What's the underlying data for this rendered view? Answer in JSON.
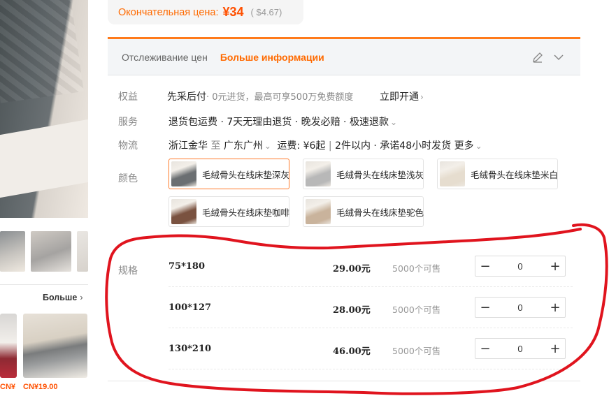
{
  "final_price": {
    "label": "Окончательная цена:",
    "value": "¥34",
    "usd": "( $4.67)"
  },
  "tracking": {
    "label": "Отслеживание цен",
    "more": "Больше информации"
  },
  "rows": {
    "benefits": {
      "label": "权益",
      "text": "先采后付",
      "sub": "· 0元进货，最高可享500万免费额度",
      "action": "立即开通"
    },
    "service": {
      "label": "服务",
      "text": "退货包运费 · 7天无理由退货 · 晚发必赔 · 极速退款"
    },
    "logistics": {
      "label": "物流",
      "from": "浙江金华",
      "to_word": "至",
      "to": "广东广州",
      "fee": "运费: ¥6起",
      "delivery": "2件以内 · 承诺48小时发货",
      "more": "更多"
    }
  },
  "colors": {
    "label": "颜色",
    "options": [
      {
        "name": "毛绒骨头在线床垫深灰",
        "selected": true,
        "tone": "#6b6f72"
      },
      {
        "name": "毛绒骨头在线床垫浅灰",
        "selected": false,
        "tone": "#b8b8b8"
      },
      {
        "name": "毛绒骨头在线床垫米白",
        "selected": false,
        "tone": "#e6ddcf"
      },
      {
        "name": "毛绒骨头在线床垫咖啡",
        "selected": false,
        "tone": "#7a5240"
      },
      {
        "name": "毛绒骨头在线床垫驼色",
        "selected": false,
        "tone": "#c9b39c"
      }
    ]
  },
  "specs": {
    "label": "规格",
    "items": [
      {
        "size": "75*180",
        "price": "29.00元",
        "stock": "5000个可售",
        "qty": "0"
      },
      {
        "size": "100*127",
        "price": "28.00元",
        "stock": "5000个可售",
        "qty": "0"
      },
      {
        "size": "130*210",
        "price": "46.00元",
        "stock": "5000个可售",
        "qty": "0"
      }
    ],
    "minus": "−",
    "plus": "+"
  },
  "left_panel": {
    "more_label": "Больше",
    "rec_price_left": "CN¥",
    "rec_price": "CN¥19.00"
  },
  "colors_theme": {
    "accent": "#ff6a00",
    "annotation": "#e0141e"
  }
}
